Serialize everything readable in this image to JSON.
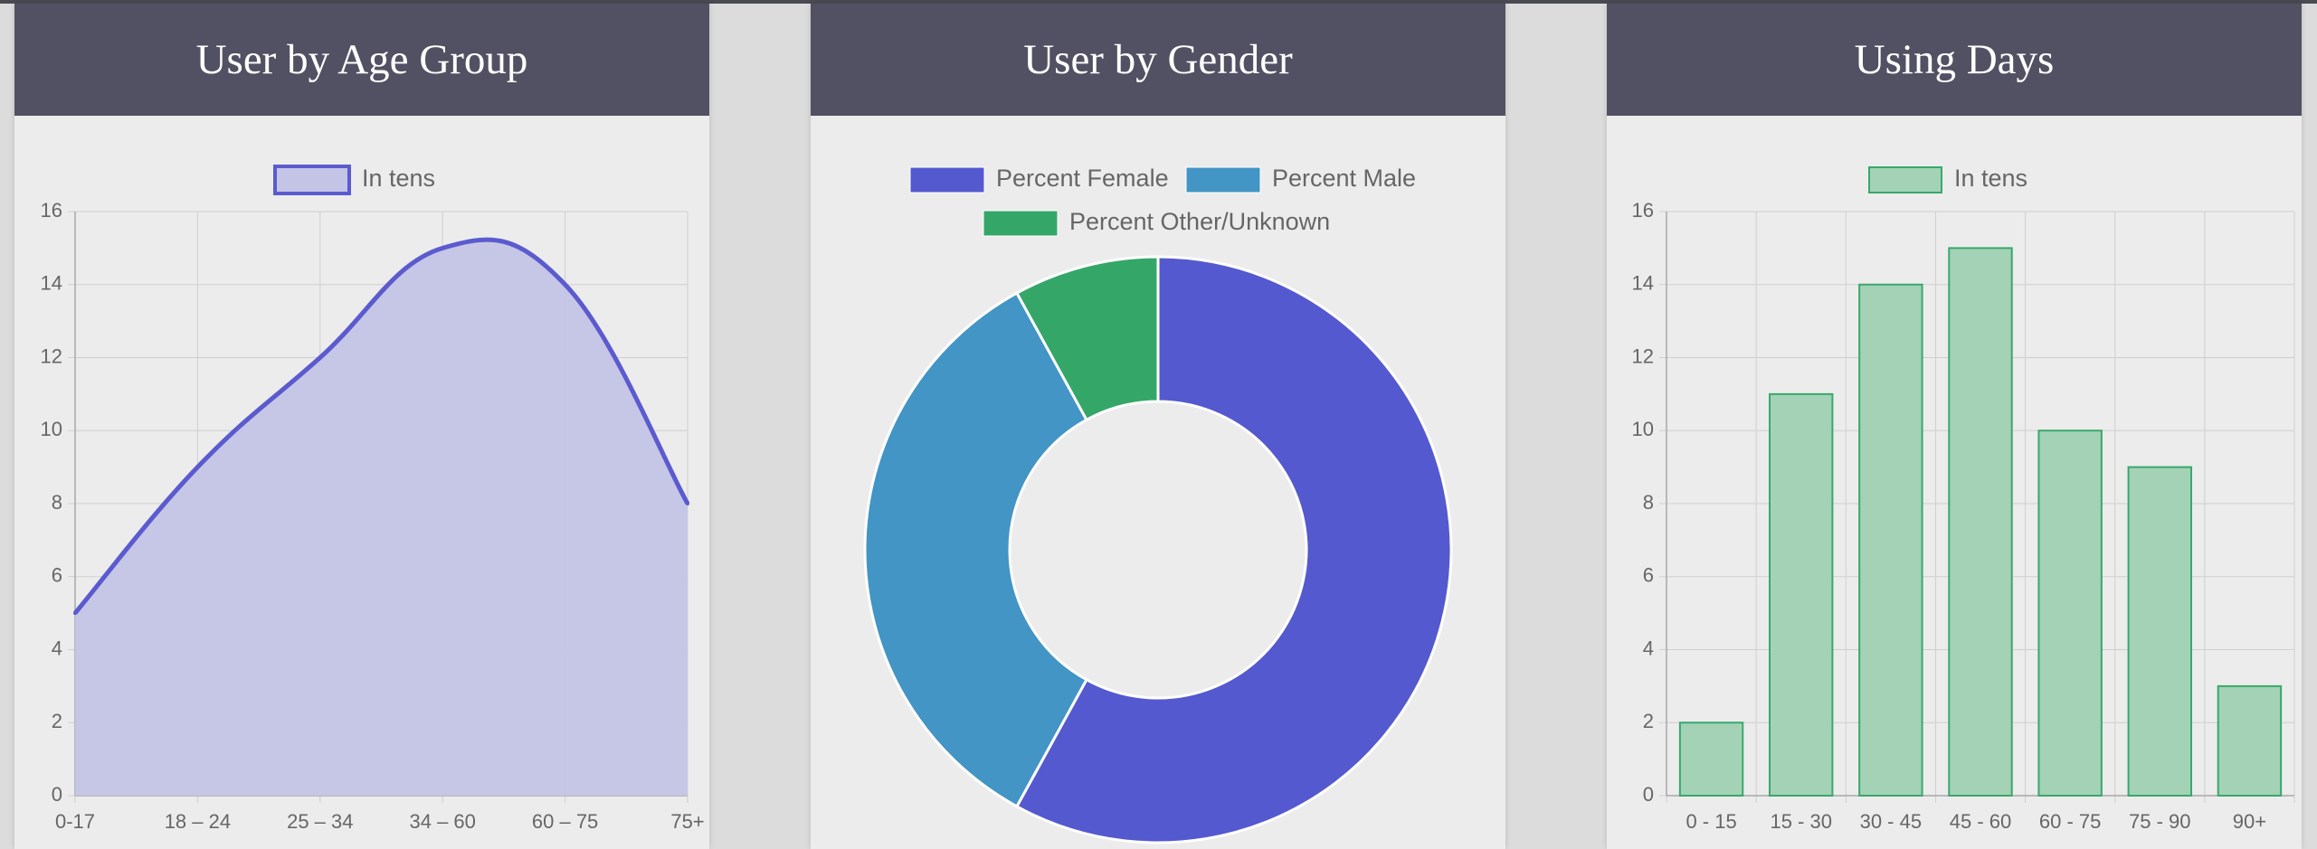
{
  "panels": {
    "age": {
      "title": "User by Age Group"
    },
    "gender": {
      "title": "User by Gender"
    },
    "days": {
      "title": "Using Days"
    }
  },
  "chart_data": [
    {
      "type": "area",
      "title": "User by Age Group",
      "legend": [
        "In tens"
      ],
      "legend_position": "top",
      "categories": [
        "0-17",
        "18 – 24",
        "25 – 34",
        "34 – 60",
        "60 – 75",
        "75+"
      ],
      "series": [
        {
          "name": "In tens",
          "values": [
            5,
            9,
            12,
            15,
            14,
            8
          ]
        }
      ],
      "ylim": [
        0,
        16
      ],
      "y_ticks": [
        0,
        2,
        4,
        6,
        8,
        10,
        12,
        14,
        16
      ],
      "grid": true,
      "colors": {
        "line": "#5b5bcf",
        "fill": "#c4c4e6"
      }
    },
    {
      "type": "pie",
      "style": "doughnut",
      "title": "User by Gender",
      "legend": [
        "Percent Female",
        "Percent Male",
        "Percent Other/Unknown"
      ],
      "legend_position": "top",
      "values": [
        58,
        34,
        8
      ],
      "colors": [
        "#5459cf",
        "#4295c4",
        "#34a768"
      ]
    },
    {
      "type": "bar",
      "title": "Using Days",
      "legend": [
        "In tens"
      ],
      "legend_position": "top",
      "categories": [
        "0 - 15",
        "15 - 30",
        "30 - 45",
        "45 - 60",
        "60 - 75",
        "75 - 90",
        "90+"
      ],
      "series": [
        {
          "name": "In tens",
          "values": [
            2,
            11,
            14,
            15,
            10,
            9,
            3
          ]
        }
      ],
      "ylim": [
        0,
        16
      ],
      "y_ticks": [
        0,
        2,
        4,
        6,
        8,
        10,
        12,
        14,
        16
      ],
      "grid": true,
      "colors": {
        "fill": "#a3d2b7",
        "border": "#3aa86a"
      }
    }
  ]
}
